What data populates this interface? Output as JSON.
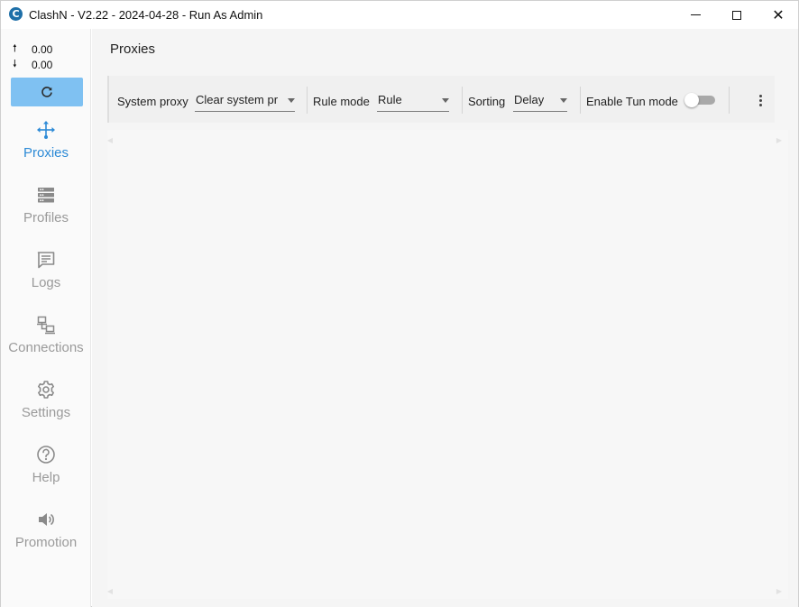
{
  "window": {
    "title": "ClashN - V2.22 - 2024-04-28 - Run As Admin",
    "app_icon_letter": "C"
  },
  "sidebar": {
    "upload_speed": "0.00",
    "download_speed": "0.00",
    "refresh_icon": "refresh-icon",
    "items": [
      {
        "label": "Proxies",
        "icon": "proxies-icon",
        "active": true
      },
      {
        "label": "Profiles",
        "icon": "profiles-icon",
        "active": false
      },
      {
        "label": "Logs",
        "icon": "logs-icon",
        "active": false
      },
      {
        "label": "Connections",
        "icon": "connections-icon",
        "active": false
      },
      {
        "label": "Settings",
        "icon": "gear-icon",
        "active": false
      },
      {
        "label": "Help",
        "icon": "help-icon",
        "active": false
      },
      {
        "label": "Promotion",
        "icon": "speaker-icon",
        "active": false
      }
    ]
  },
  "main": {
    "title": "Proxies",
    "toolbar": {
      "system_proxy_label": "System proxy",
      "system_proxy_value": "Clear system pr",
      "rule_mode_label": "Rule mode",
      "rule_mode_value": "Rule",
      "sorting_label": "Sorting",
      "sorting_value": "Delay",
      "tun_mode_label": "Enable Tun mode",
      "tun_mode_enabled": false
    }
  },
  "colors": {
    "accent": "#2c8ad6",
    "refresh_button": "#7fc1f2",
    "inactive_nav": "#9a9a9a"
  }
}
